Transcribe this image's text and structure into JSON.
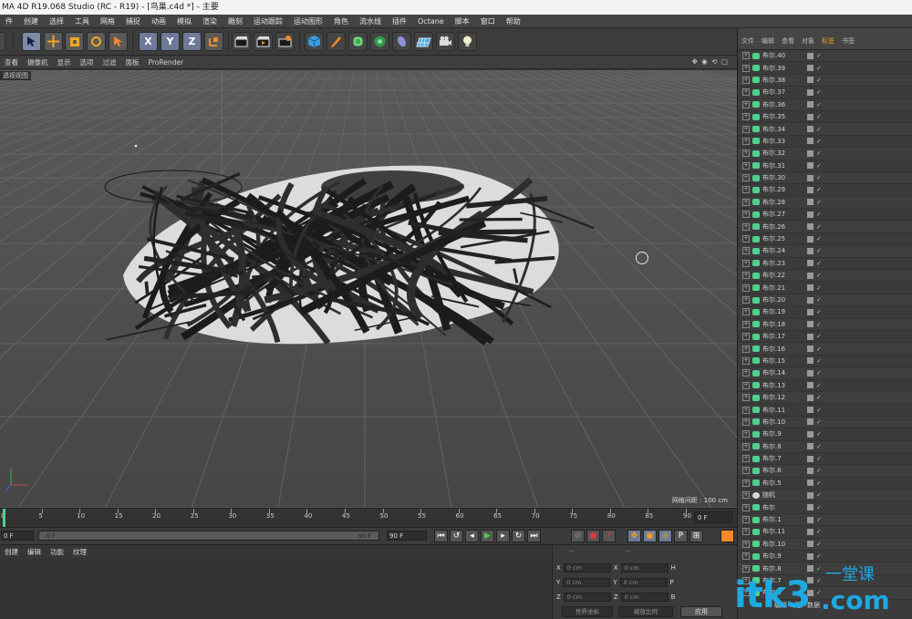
{
  "window": {
    "title": "MA 4D R19.068 Studio (RC - R19) - [鸟巢.c4d *] - 主要"
  },
  "menu": [
    "件",
    "创建",
    "选择",
    "工具",
    "网格",
    "捕捉",
    "动画",
    "模拟",
    "渲染",
    "雕刻",
    "运动跟踪",
    "运动图形",
    "角色",
    "流水线",
    "插件",
    "Octane",
    "脚本",
    "窗口",
    "帮助"
  ],
  "toolbar": {
    "axes": [
      "X",
      "Y",
      "Z"
    ]
  },
  "viewport_menu": [
    "查看",
    "摄像机",
    "显示",
    "选项",
    "过滤",
    "面板",
    "ProRender"
  ],
  "viewport": {
    "label": "透视视图",
    "grid_spacing": "网格间距 : 100 cm"
  },
  "timeline": {
    "ticks": [
      "0",
      "5",
      "10",
      "15",
      "20",
      "25",
      "30",
      "35",
      "40",
      "45",
      "50",
      "55",
      "60",
      "65",
      "70",
      "75",
      "80",
      "85",
      "90"
    ],
    "current_frame": "0 F",
    "start_frame": "0 F",
    "slider_start": "0 F",
    "slider_end": "90 F",
    "end_frame": "90 F"
  },
  "material_tabs": [
    "创建",
    "编辑",
    "功能",
    "纹理"
  ],
  "coordinates": {
    "rows": [
      {
        "axis": "X",
        "a": "0 cm",
        "axis2": "X",
        "b": "0 cm",
        "axis3": "H"
      },
      {
        "axis": "Y",
        "a": "0 cm",
        "axis2": "Y",
        "b": "0 cm",
        "axis3": "P"
      },
      {
        "axis": "Z",
        "a": "0 cm",
        "axis2": "Z",
        "b": "0 cm",
        "axis3": "B"
      }
    ],
    "mode_left": "世界坐标",
    "mode_right": "缩放比例",
    "apply_label": "应用",
    "header_left": "--",
    "header_right": "--"
  },
  "objects_panel": {
    "tabs": [
      "文件",
      "编辑",
      "查看",
      "对象",
      "标签",
      "书签"
    ],
    "items": [
      "布尔.40",
      "布尔.39",
      "布尔.38",
      "布尔.37",
      "布尔.36",
      "布尔.35",
      "布尔.34",
      "布尔.33",
      "布尔.32",
      "布尔.31",
      "布尔.30",
      "布尔.29",
      "布尔.28",
      "布尔.27",
      "布尔.26",
      "布尔.25",
      "布尔.24",
      "布尔.23",
      "布尔.22",
      "布尔.21",
      "布尔.20",
      "布尔.19",
      "布尔.18",
      "布尔.17",
      "布尔.16",
      "布尔.15",
      "布尔.14",
      "布尔.13",
      "布尔.12",
      "布尔.11",
      "布尔.10",
      "布尔.9",
      "布尔.8",
      "布尔.7",
      "布尔.6",
      "布尔.5",
      "随机",
      "布尔",
      "布尔.1",
      "布尔.11",
      "布尔.10",
      "布尔.9",
      "布尔.8",
      "布尔.7",
      "布尔.5"
    ],
    "footer": [
      "编辑",
      "用户数据"
    ]
  },
  "watermark": {
    "main": "itk3",
    "suffix": ".com",
    "cn": "一堂课"
  },
  "colors": {
    "accent": "#4fd08e",
    "selected_tool": "#7d8ca8",
    "watermark": "#1ea9e1"
  }
}
